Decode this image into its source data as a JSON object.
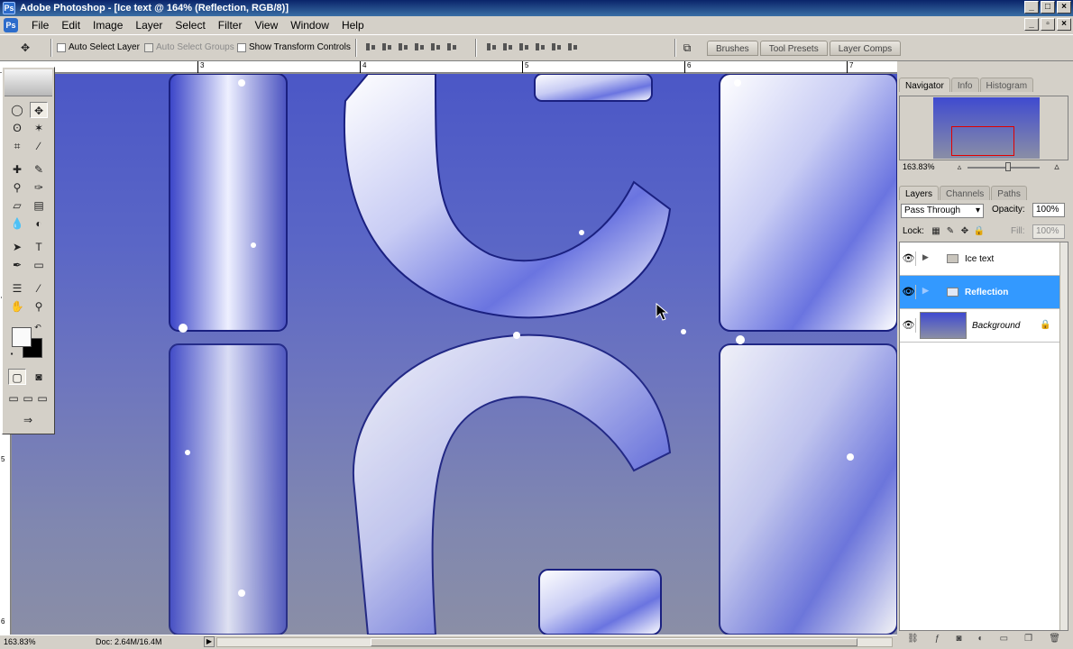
{
  "window": {
    "title": "Adobe Photoshop - [Ice text @ 164% (Reflection, RGB/8)]",
    "controls": [
      "_",
      "□",
      "×"
    ],
    "doc_controls": [
      "_",
      "▫",
      "×"
    ]
  },
  "menu": [
    "File",
    "Edit",
    "Image",
    "Layer",
    "Select",
    "Filter",
    "View",
    "Window",
    "Help"
  ],
  "options": {
    "auto_select_layer": "Auto Select Layer",
    "auto_select_groups": "Auto Select Groups",
    "show_transform_controls": "Show Transform Controls"
  },
  "palette_well": [
    "Brushes",
    "Tool Presets",
    "Layer Comps"
  ],
  "rulers": {
    "top": [
      "3",
      "4",
      "5",
      "6",
      "7"
    ],
    "left": [
      "4",
      "5",
      "6"
    ]
  },
  "statusbar": {
    "zoom": "163.83%",
    "doc": "Doc: 2.64M/16.4M"
  },
  "navigator": {
    "tabs": [
      "Navigator",
      "Info",
      "Histogram"
    ],
    "zoom": "163.83%"
  },
  "layers": {
    "tabs": [
      "Layers",
      "Channels",
      "Paths"
    ],
    "blend_mode": "Pass Through",
    "opacity_label": "Opacity:",
    "opacity": "100%",
    "lock_label": "Lock:",
    "fill_label": "Fill:",
    "fill": "100%",
    "items": [
      {
        "name": "Ice text",
        "type": "group",
        "selected": false
      },
      {
        "name": "Reflection",
        "type": "group",
        "selected": true
      },
      {
        "name": "Background",
        "type": "background",
        "selected": false
      }
    ]
  },
  "colors": {
    "selection": "#3399ff",
    "canvas_top": "#4b57c6",
    "canvas_bottom": "#8a8ea6",
    "title_bar": "#0a246a"
  }
}
